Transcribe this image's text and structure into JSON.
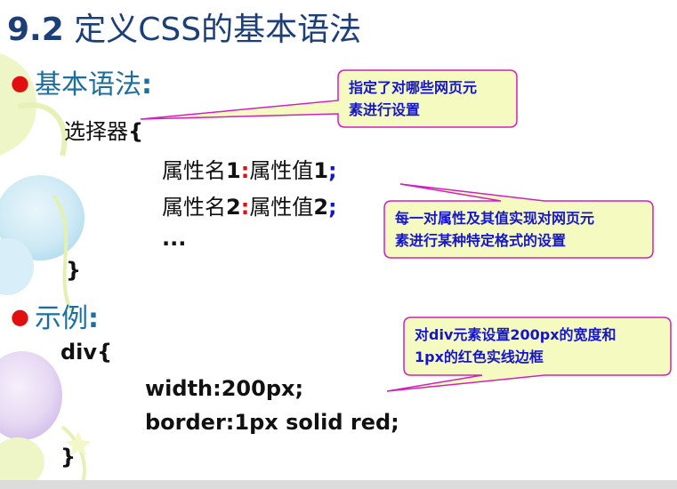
{
  "slide": {
    "title_num": "9.2",
    "title_text": " 定义CSS的基本语法",
    "section1": {
      "label": "基本语法",
      "colon": ":"
    },
    "selector_line": {
      "text": "选择器",
      "brace": "{"
    },
    "prop1": {
      "name": "属性名",
      "name_num": "1",
      "sep": ":",
      "value": "属性值",
      "value_num": "1",
      "end": ";"
    },
    "prop2": {
      "name": "属性名",
      "name_num": "2",
      "sep": ":",
      "value": "属性值",
      "value_num": "2",
      "end": ";"
    },
    "ellipsis": "...",
    "close_brace": "}",
    "section2": {
      "label": "示例",
      "colon": ":"
    },
    "example": {
      "open": "div{",
      "line1": "width:200px;",
      "line2": "border:1px solid red;",
      "close": "}"
    },
    "callout1": {
      "line1": "指定了对哪些网页元",
      "line2": "素进行设置"
    },
    "callout2": {
      "line1": "每一对属性及其值实现对网页元",
      "line2": "素进行某种特定格式的设置"
    },
    "callout3": {
      "line1": "对div元素设置200px的宽度和",
      "line2": "1px的红色实线边框"
    }
  },
  "colors": {
    "title": "#1c3f78",
    "section": "#1a6f9e",
    "bullet": "#e01010",
    "note_text": "#1515d0",
    "note_fill": "#f5fbc0",
    "note_border": "#d020c0"
  }
}
